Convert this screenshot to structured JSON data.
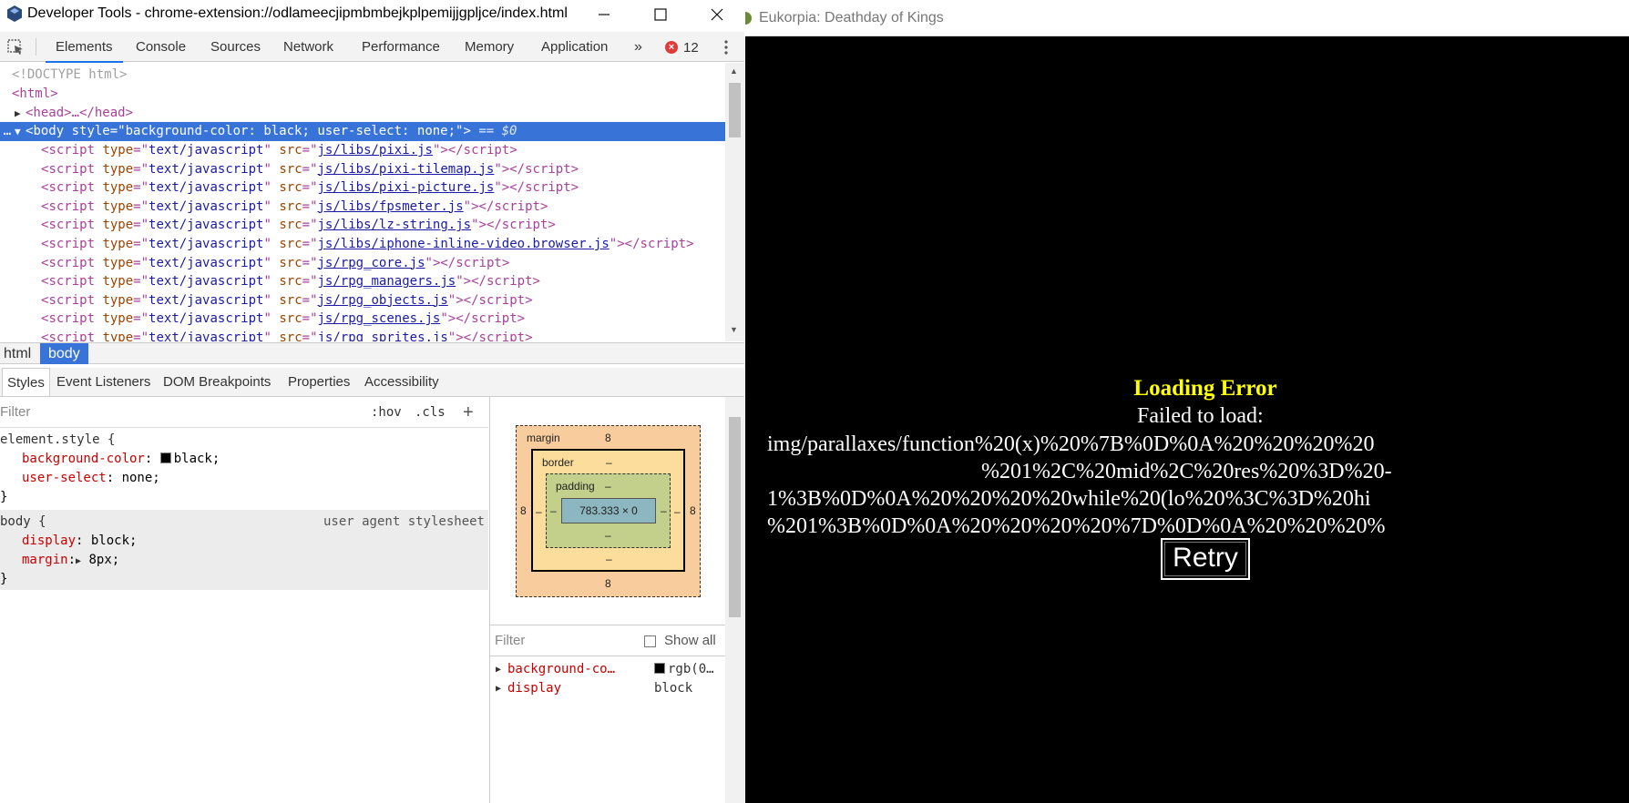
{
  "devtools": {
    "window_title": "Developer Tools - chrome-extension://odlameecjipmbmbejkplpemijjgpljce/index.html",
    "tabs": [
      "Elements",
      "Console",
      "Sources",
      "Network",
      "Performance",
      "Memory",
      "Application"
    ],
    "more_tabs": "»",
    "error_count": "12",
    "dom_lines": {
      "doctype": "<!DOCTYPE html>",
      "html_open": "<html>",
      "head": "<head>…</head>",
      "body_prefix": "…",
      "body_tag": "body",
      "body_attr": "style",
      "body_value": "background-color: black; user-select: none;",
      "body_eq": "== $0"
    },
    "scripts": [
      "js/libs/pixi.js",
      "js/libs/pixi-tilemap.js",
      "js/libs/pixi-picture.js",
      "js/libs/fpsmeter.js",
      "js/libs/lz-string.js",
      "js/libs/iphone-inline-video.browser.js",
      "js/rpg_core.js",
      "js/rpg_managers.js",
      "js/rpg_objects.js",
      "js/rpg_scenes.js",
      "js/rpg_sprites.js"
    ],
    "script_tag": "script",
    "script_type_attr": "type",
    "script_type_value": "text/javascript",
    "script_src_attr": "src",
    "breadcrumbs": [
      "html",
      "body"
    ],
    "subtabs": [
      "Styles",
      "Event Listeners",
      "DOM Breakpoints",
      "Properties",
      "Accessibility"
    ],
    "styles": {
      "filter_placeholder": "Filter",
      "hov": ":hov",
      "cls": ".cls",
      "plus": "+",
      "element_style_selector": "element.style {",
      "element_props": [
        {
          "name": "background-color",
          "value": "black;"
        },
        {
          "name": "user-select",
          "value": "none;"
        }
      ],
      "close_brace": "}",
      "body_selector": "body {",
      "body_source": "user agent stylesheet",
      "body_props": [
        {
          "name": "display",
          "value": "block;"
        },
        {
          "name": "margin",
          "value": "8px;"
        }
      ]
    },
    "box_model": {
      "margin_label": "margin",
      "margin_top": "8",
      "margin_bottom": "8",
      "margin_left": "8",
      "margin_right": "8",
      "border_label": "border",
      "border_top": "–",
      "border_bottom": "–",
      "border_left": "–",
      "border_right": "–",
      "padding_label": "padding",
      "padding_top": "–",
      "padding_bottom": "–",
      "padding_left": "–",
      "padding_right": "–",
      "content": "783.333 × 0"
    },
    "computed": {
      "filter_placeholder": "Filter",
      "show_all": "Show all",
      "rows": [
        {
          "name": "background-co…",
          "value": "rgb(0…"
        },
        {
          "name": "display",
          "value": "block"
        }
      ]
    }
  },
  "game": {
    "window_title": "Eukorpia: Deathday of Kings",
    "error_title": "Loading Error",
    "failed_to_load": "Failed to load:",
    "path_lines": [
      "img/parallaxes/function%20(x)%20%7B%0D%0A%20%20%20%20",
      "%201%2C%20mid%2C%20res%20%3D%20-",
      "1%3B%0D%0A%20%20%20%20while%20(lo%20%3C%3D%20hi",
      "%201%3B%0D%0A%20%20%20%20%7D%0D%0A%20%20%20%"
    ],
    "retry_label": "Retry"
  },
  "colors": {
    "selection": "#3874d8",
    "error_yellow": "#ffff00",
    "tab_underline": "#1a73e8"
  }
}
